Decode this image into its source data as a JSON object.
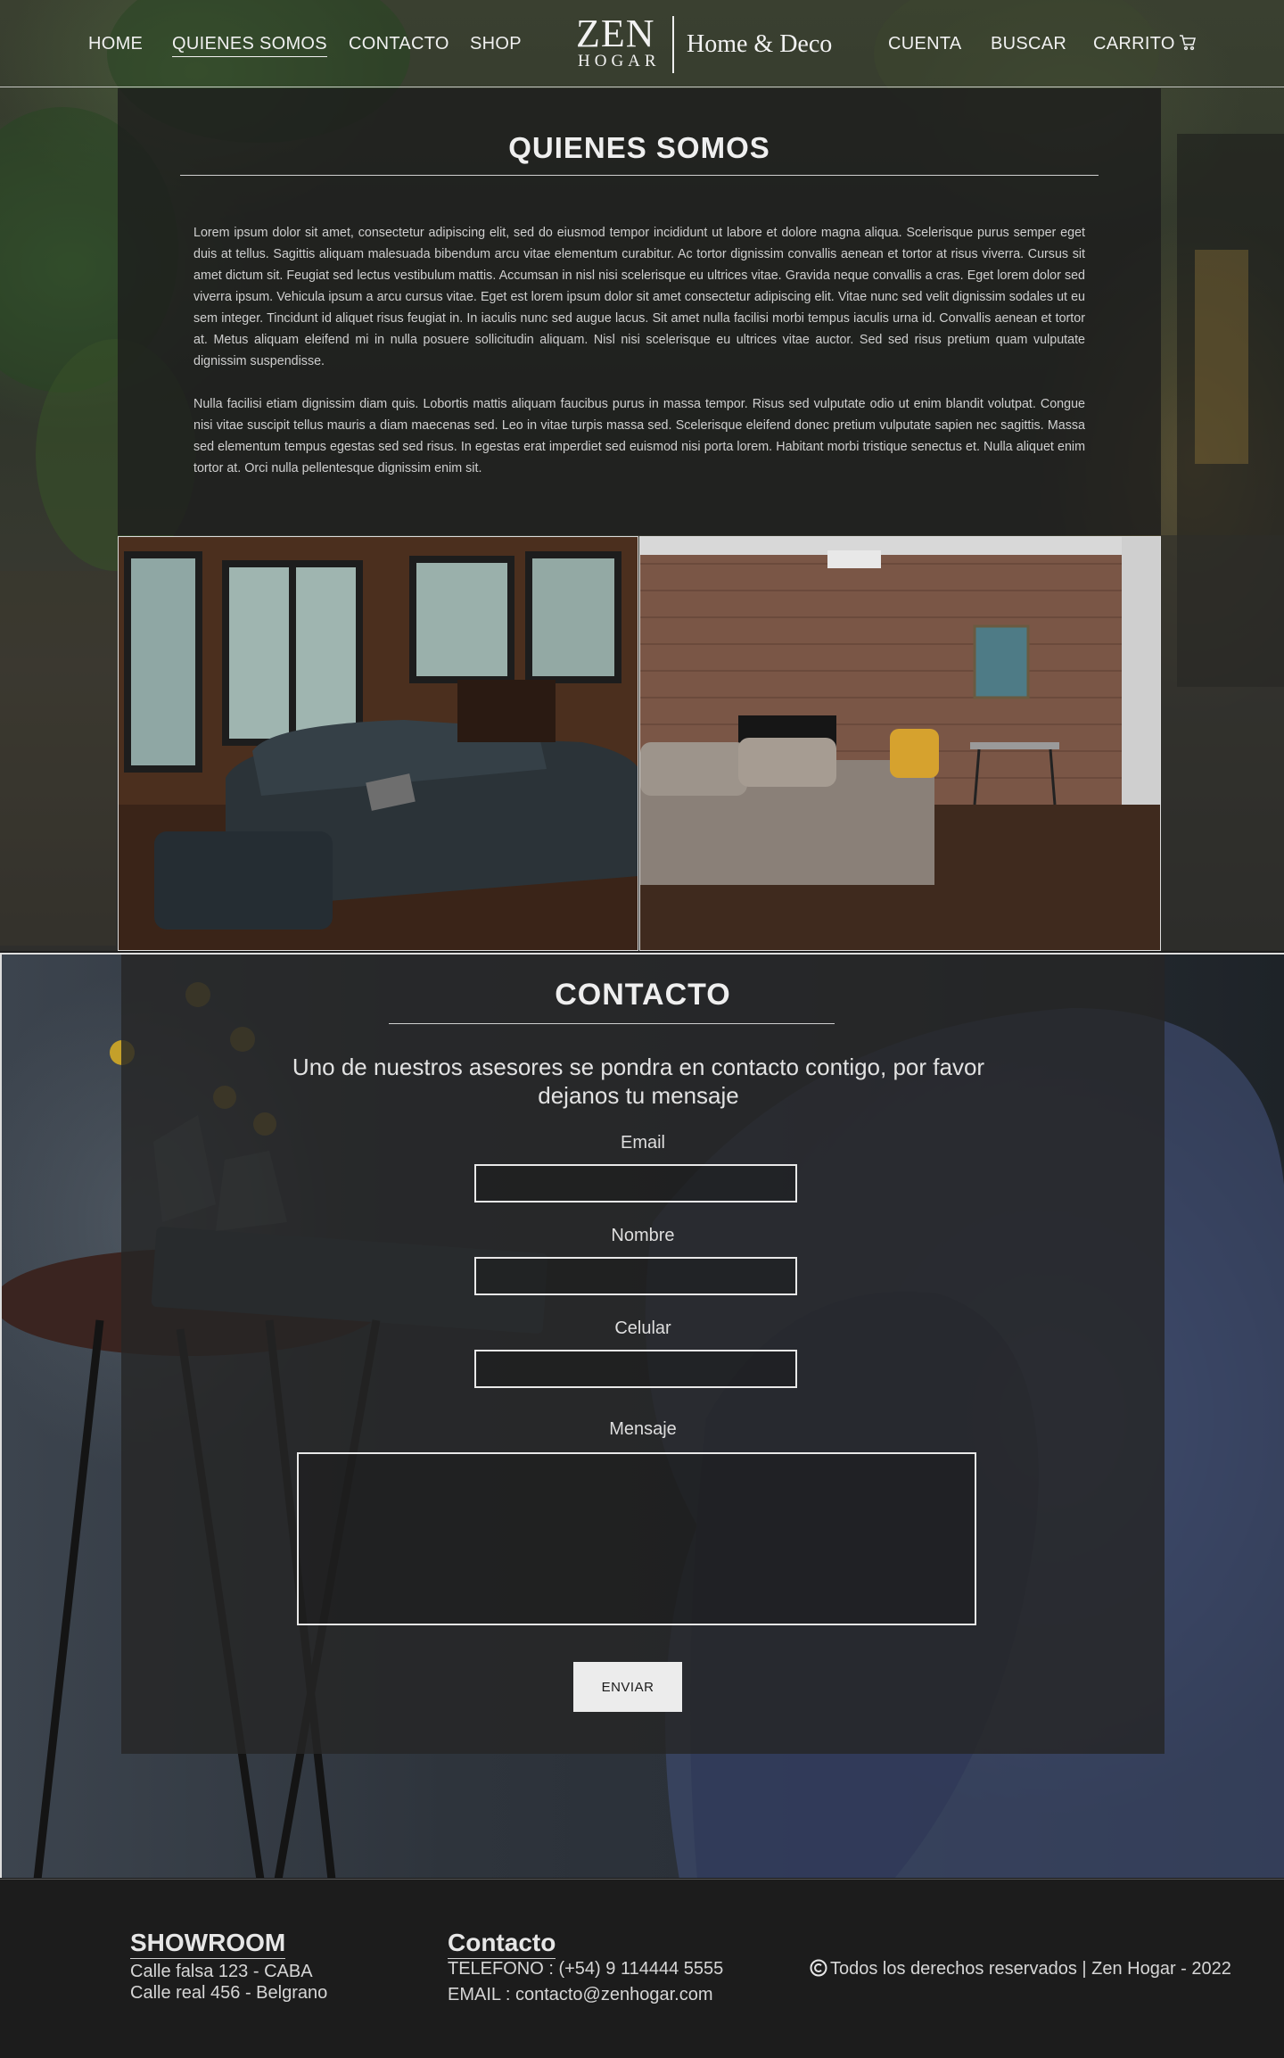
{
  "header": {
    "nav_left": [
      "HOME",
      "QUIENES SOMOS",
      "CONTACTO",
      "SHOP"
    ],
    "logo": {
      "zen": "ZEN",
      "hogar": "HOGAR",
      "subtitle": "Home & Deco"
    },
    "nav_right": {
      "cuenta": "CUENTA",
      "buscar": "BUSCAR",
      "carrito": "CARRITO"
    },
    "active_item": "QUIENES SOMOS",
    "cart_icon": "cart-icon"
  },
  "about": {
    "title": "QUIENES SOMOS",
    "paragraph_1": "Lorem ipsum dolor sit amet, consectetur adipiscing elit, sed do eiusmod tempor incididunt ut labore et dolore magna aliqua. Scelerisque purus semper eget duis at tellus. Sagittis aliquam malesuada bibendum arcu vitae elementum curabitur. Ac tortor dignissim convallis aenean et tortor at risus viverra. Cursus sit amet dictum sit. Feugiat sed lectus vestibulum mattis. Accumsan in nisl nisi scelerisque eu ultrices vitae. Gravida neque convallis a cras. Eget lorem dolor sed viverra ipsum. Vehicula ipsum a arcu cursus vitae. Eget est lorem ipsum dolor sit amet consectetur adipiscing elit. Vitae nunc sed velit dignissim sodales ut eu sem integer. Tincidunt id aliquet risus feugiat in. In iaculis nunc sed augue lacus. Sit amet nulla facilisi morbi tempus iaculis urna id. Convallis aenean et tortor at. Metus aliquam eleifend mi in nulla posuere sollicitudin aliquam. Nisl nisi scelerisque eu ultrices vitae auctor. Sed sed risus pretium quam vulputate dignissim suspendisse.",
    "paragraph_2": "Nulla facilisi etiam dignissim diam quis. Lobortis mattis aliquam faucibus purus in massa tempor. Risus sed vulputate odio ut enim blandit volutpat. Congue nisi vitae suscipit tellus mauris a diam maecenas sed. Leo in vitae turpis massa sed. Scelerisque eleifend donec pretium vulputate sapien nec sagittis. Massa sed elementum tempus egestas sed sed risus. In egestas erat imperdiet sed euismod nisi porta lorem. Habitant morbi tristique senectus et. Nulla aliquet enim tortor at. Orci nulla pellentesque dignissim enim sit."
  },
  "contact": {
    "title": "CONTACTO",
    "subtitle": "Uno de nuestros asesores se pondra en contacto contigo, por favor dejanos tu mensaje",
    "fields": {
      "email": {
        "label": "Email",
        "value": ""
      },
      "nombre": {
        "label": "Nombre",
        "value": ""
      },
      "celular": {
        "label": "Celular",
        "value": ""
      },
      "mensaje": {
        "label": "Mensaje",
        "value": ""
      }
    },
    "submit_label": "ENVIAR"
  },
  "footer": {
    "showroom": {
      "title": "SHOWROOM",
      "lines": [
        "Calle falsa 123 - CABA",
        "Calle real 456 - Belgrano"
      ]
    },
    "contacto": {
      "title": "Contacto",
      "telefono": "TELEFONO : (+54) 9 114444 5555",
      "email": "EMAIL : contacto@zenhogar.com"
    },
    "copyright": "Todos los derechos reservados | Zen Hogar - 2022",
    "copyright_icon": "copyright-icon"
  }
}
